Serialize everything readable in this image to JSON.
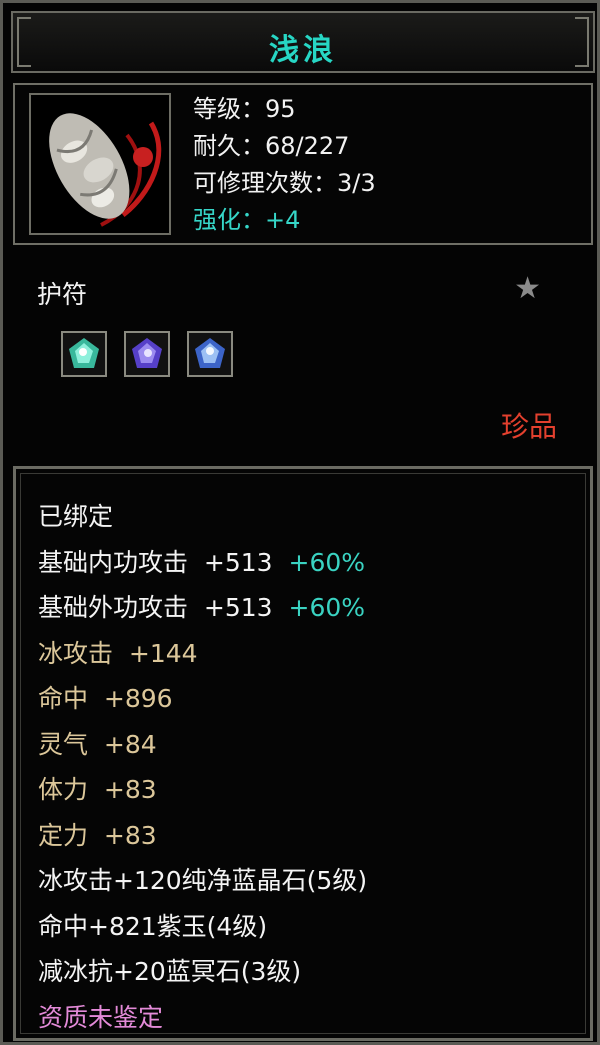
{
  "item": {
    "name": "浅浪",
    "level_label": "等级：",
    "level": "95",
    "durability_label": "耐久：",
    "durability": "68/227",
    "repair_label": "可修理次数：",
    "repair": "3/3",
    "enhance_label": "强化：",
    "enhance": "+4",
    "type": "护符",
    "rarity": "珍品",
    "icon": "jade-pendant-icon",
    "gems": [
      "green-gem-icon",
      "purple-gem-icon",
      "blue-gem-icon"
    ]
  },
  "details": {
    "bound": "已绑定",
    "attrs": [
      {
        "name": "基础内功攻击",
        "value": "+513",
        "bonus": "+60%"
      },
      {
        "name": "基础外功攻击",
        "value": "+513",
        "bonus": "+60%"
      },
      {
        "name": "冰攻击",
        "value": "+144"
      },
      {
        "name": "命中",
        "value": "+896"
      },
      {
        "name": "灵气",
        "value": "+84"
      },
      {
        "name": "体力",
        "value": "+83"
      },
      {
        "name": "定力",
        "value": "+83"
      }
    ],
    "socket_lines": [
      "冰攻击+120纯净蓝晶石(5级)",
      "命中+821紫玉(4级)",
      "减冰抗+20蓝冥石(3级)"
    ],
    "aptitude": "资质未鉴定"
  },
  "colors": {
    "title": "#27d6c4",
    "rarity": "#e3402e",
    "attr_gold": "#dcc79a",
    "bonus_teal": "#3ad3c2",
    "aptitude_pink": "#e38ad8"
  }
}
